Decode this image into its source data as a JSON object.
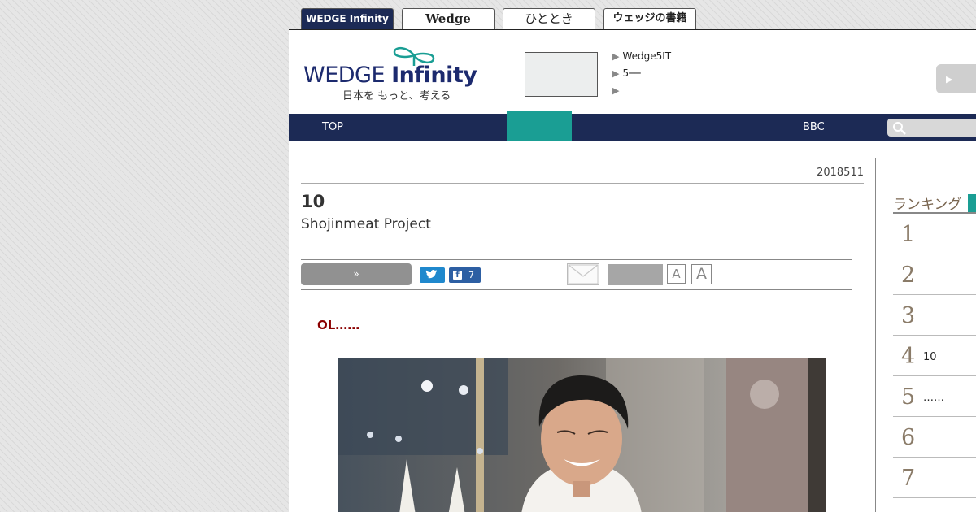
{
  "site_tabs": [
    {
      "label": "WEDGE Infinity",
      "active": true
    },
    {
      "label": "Wedge",
      "active": false
    },
    {
      "label": "ひととき",
      "active": false
    },
    {
      "label": "ウェッジの書籍",
      "active": false
    }
  ],
  "header": {
    "logo_word_a": "WEDGE",
    "logo_word_b": "Infinity",
    "logo_tagline": "日本を もっと、考える",
    "links": [
      "Wedge5IT",
      "5──",
      ""
    ],
    "button_arrow": "▶"
  },
  "nav": {
    "top_label": "TOP",
    "active_label": "",
    "bbc_label": "BBC",
    "search_placeholder": ""
  },
  "article": {
    "date": "2018511",
    "title": "10",
    "subtitle": "Shojinmeat Project",
    "share": {
      "next_label": "»",
      "facebook_count": "7",
      "font_small": "A",
      "font_large": "A"
    },
    "lead": "OL……"
  },
  "ranking": {
    "title": "ランキング",
    "items": [
      {
        "rank": "1",
        "text": ""
      },
      {
        "rank": "2",
        "text": ""
      },
      {
        "rank": "3",
        "text": ""
      },
      {
        "rank": "4",
        "text": "10"
      },
      {
        "rank": "5",
        "text": "……"
      },
      {
        "rank": "6",
        "text": ""
      },
      {
        "rank": "7",
        "text": ""
      }
    ]
  },
  "colors": {
    "navy": "#1c2a55",
    "teal": "#1a9e94",
    "lead_red": "#8b0000"
  }
}
